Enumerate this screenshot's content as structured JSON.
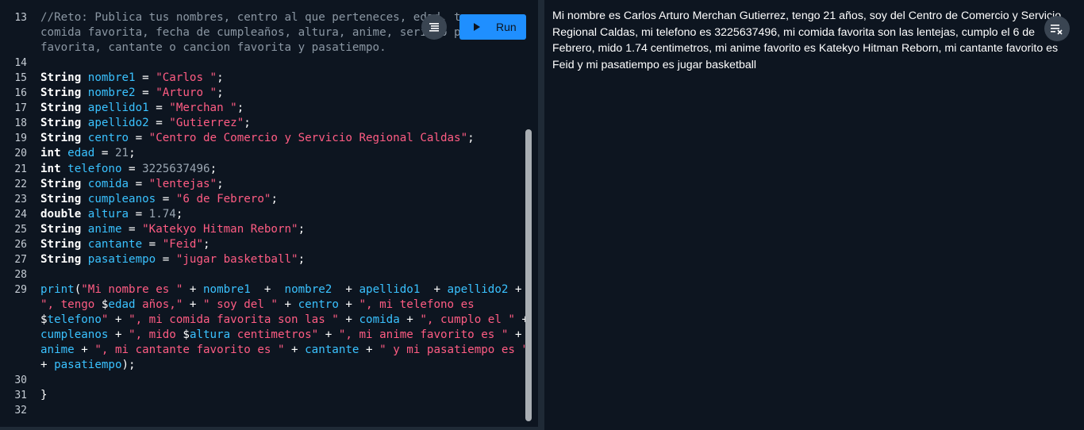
{
  "editor": {
    "run_label": "Run",
    "lines": [
      {
        "n": "13",
        "segs": [
          [
            "cmt",
            "//Reto: Publica tus nombres, centro al que perteneces, edad, te"
          ]
        ]
      },
      {
        "n": "",
        "segs": [
          [
            "cmt",
            "comida favorita, fecha de cumpleaños, altura, anime, serie o pe"
          ]
        ]
      },
      {
        "n": "",
        "segs": [
          [
            "cmt",
            "favorita, cantante o cancion favorita y pasatiempo."
          ]
        ]
      },
      {
        "n": "14",
        "segs": []
      },
      {
        "n": "15",
        "segs": [
          [
            "kw",
            "String "
          ],
          [
            "var",
            "nombre1"
          ],
          [
            "op",
            " = "
          ],
          [
            "str",
            "\"Carlos \""
          ],
          [
            "op",
            ";"
          ]
        ]
      },
      {
        "n": "16",
        "segs": [
          [
            "kw",
            "String "
          ],
          [
            "var",
            "nombre2"
          ],
          [
            "op",
            " = "
          ],
          [
            "str",
            "\"Arturo \""
          ],
          [
            "op",
            ";"
          ]
        ]
      },
      {
        "n": "17",
        "segs": [
          [
            "kw",
            "String "
          ],
          [
            "var",
            "apellido1"
          ],
          [
            "op",
            " = "
          ],
          [
            "str",
            "\"Merchan \""
          ],
          [
            "op",
            ";"
          ]
        ]
      },
      {
        "n": "18",
        "segs": [
          [
            "kw",
            "String "
          ],
          [
            "var",
            "apellido2"
          ],
          [
            "op",
            " = "
          ],
          [
            "str",
            "\"Gutierrez\""
          ],
          [
            "op",
            ";"
          ]
        ]
      },
      {
        "n": "19",
        "segs": [
          [
            "kw",
            "String "
          ],
          [
            "var",
            "centro"
          ],
          [
            "op",
            " = "
          ],
          [
            "str",
            "\"Centro de Comercio y Servicio Regional Caldas\""
          ],
          [
            "op",
            ";"
          ]
        ]
      },
      {
        "n": "20",
        "segs": [
          [
            "kw",
            "int "
          ],
          [
            "var",
            "edad"
          ],
          [
            "op",
            " = "
          ],
          [
            "num",
            "21"
          ],
          [
            "op",
            ";"
          ]
        ]
      },
      {
        "n": "21",
        "segs": [
          [
            "kw",
            "int "
          ],
          [
            "var",
            "telefono"
          ],
          [
            "op",
            " = "
          ],
          [
            "num",
            "3225637496"
          ],
          [
            "op",
            ";"
          ]
        ]
      },
      {
        "n": "22",
        "segs": [
          [
            "kw",
            "String "
          ],
          [
            "var",
            "comida"
          ],
          [
            "op",
            " = "
          ],
          [
            "str",
            "\"lentejas\""
          ],
          [
            "op",
            ";"
          ]
        ]
      },
      {
        "n": "23",
        "segs": [
          [
            "kw",
            "String "
          ],
          [
            "var",
            "cumpleanos"
          ],
          [
            "op",
            " = "
          ],
          [
            "str",
            "\"6 de Febrero\""
          ],
          [
            "op",
            ";"
          ]
        ]
      },
      {
        "n": "24",
        "segs": [
          [
            "kw",
            "double "
          ],
          [
            "var",
            "altura"
          ],
          [
            "op",
            " = "
          ],
          [
            "num",
            "1.74"
          ],
          [
            "op",
            ";"
          ]
        ]
      },
      {
        "n": "25",
        "segs": [
          [
            "kw",
            "String "
          ],
          [
            "var",
            "anime"
          ],
          [
            "op",
            " = "
          ],
          [
            "str",
            "\"Katekyo Hitman Reborn\""
          ],
          [
            "op",
            ";"
          ]
        ]
      },
      {
        "n": "26",
        "segs": [
          [
            "kw",
            "String "
          ],
          [
            "var",
            "cantante"
          ],
          [
            "op",
            " = "
          ],
          [
            "str",
            "\"Feid\""
          ],
          [
            "op",
            ";"
          ]
        ]
      },
      {
        "n": "27",
        "segs": [
          [
            "kw",
            "String "
          ],
          [
            "var",
            "pasatiempo"
          ],
          [
            "op",
            " = "
          ],
          [
            "str",
            "\"jugar basketball\""
          ],
          [
            "op",
            ";"
          ]
        ]
      },
      {
        "n": "28",
        "segs": []
      },
      {
        "n": "29",
        "segs": [
          [
            "fn",
            "print"
          ],
          [
            "op",
            "("
          ],
          [
            "str",
            "\"Mi nombre es \""
          ],
          [
            "op",
            " + "
          ],
          [
            "var",
            "nombre1"
          ],
          [
            "op",
            "  +  "
          ],
          [
            "var",
            "nombre2"
          ],
          [
            "op",
            "  + "
          ],
          [
            "var",
            "apellido1"
          ],
          [
            "op",
            "  + "
          ],
          [
            "var",
            "apellido2"
          ],
          [
            "op",
            " +"
          ]
        ]
      },
      {
        "n": "",
        "segs": [
          [
            "str",
            "\", tengo "
          ],
          [
            "op",
            "$"
          ],
          [
            "var",
            "edad"
          ],
          [
            "str",
            " años,\""
          ],
          [
            "op",
            " + "
          ],
          [
            "str",
            "\" soy del \""
          ],
          [
            "op",
            " + "
          ],
          [
            "var",
            "centro"
          ],
          [
            "op",
            " + "
          ],
          [
            "str",
            "\", mi telefono es"
          ]
        ]
      },
      {
        "n": "",
        "segs": [
          [
            "op",
            "$"
          ],
          [
            "var",
            "telefono"
          ],
          [
            "str",
            "\""
          ],
          [
            "op",
            " + "
          ],
          [
            "str",
            "\", mi comida favorita son las \""
          ],
          [
            "op",
            " + "
          ],
          [
            "var",
            "comida"
          ],
          [
            "op",
            " + "
          ],
          [
            "str",
            "\", cumplo el \""
          ],
          [
            "op",
            " +"
          ]
        ]
      },
      {
        "n": "",
        "segs": [
          [
            "var",
            "cumpleanos"
          ],
          [
            "op",
            " + "
          ],
          [
            "str",
            "\", mido "
          ],
          [
            "op",
            "$"
          ],
          [
            "var",
            "altura"
          ],
          [
            "str",
            " centimetros\""
          ],
          [
            "op",
            " + "
          ],
          [
            "str",
            "\", mi anime favorito es \""
          ],
          [
            "op",
            " +"
          ]
        ]
      },
      {
        "n": "",
        "segs": [
          [
            "var",
            "anime"
          ],
          [
            "op",
            " + "
          ],
          [
            "str",
            "\", mi cantante favorito es \""
          ],
          [
            "op",
            " + "
          ],
          [
            "var",
            "cantante"
          ],
          [
            "op",
            " + "
          ],
          [
            "str",
            "\" y mi pasatiempo es \""
          ]
        ]
      },
      {
        "n": "",
        "segs": [
          [
            "op",
            "+ "
          ],
          [
            "var",
            "pasatiempo"
          ],
          [
            "op",
            ");"
          ]
        ]
      },
      {
        "n": "30",
        "segs": []
      },
      {
        "n": "31",
        "segs": [
          [
            "op",
            "}"
          ]
        ]
      },
      {
        "n": "32",
        "segs": []
      }
    ]
  },
  "console": {
    "output": "Mi nombre es Carlos Arturo Merchan Gutierrez, tengo 21 años, soy del Centro de Comercio y Servicio Regional Caldas, mi telefono es 3225637496, mi comida favorita son las lentejas, cumplo el 6 de Febrero, mido 1.74 centimetros, mi anime favorito es Katekyo Hitman Reborn, mi cantante favorito es Feid y mi pasatiempo es jugar basketball"
  },
  "icons": {
    "format": "format-icon",
    "run": "play-icon",
    "clear": "clear-output-icon"
  }
}
